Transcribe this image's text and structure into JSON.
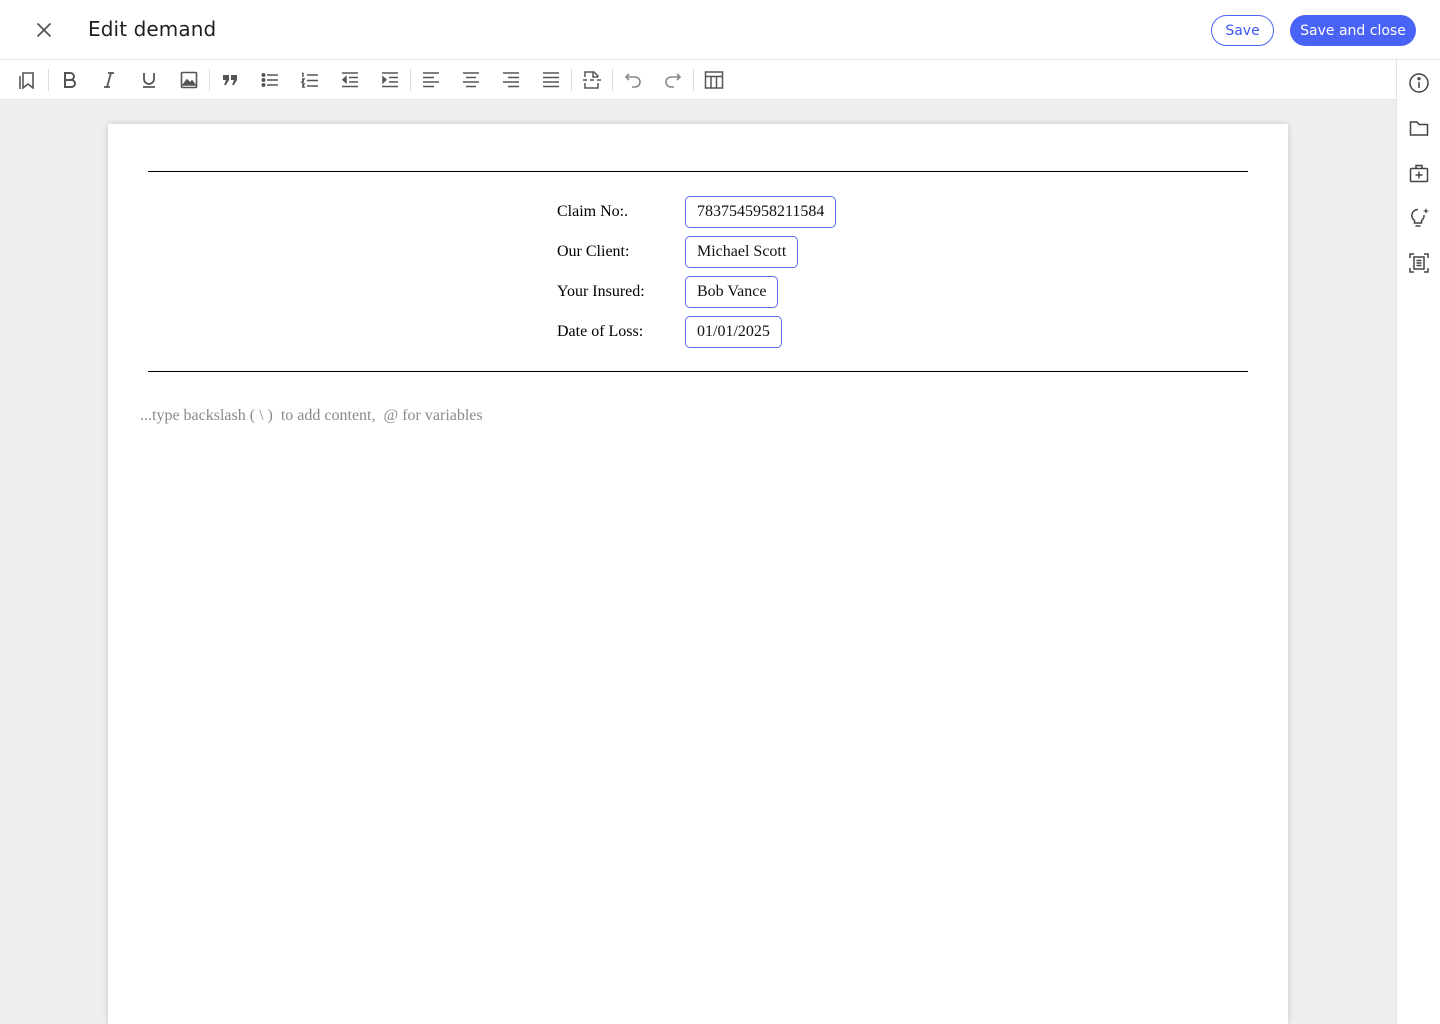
{
  "header": {
    "title": "Edit demand",
    "save_label": "Save",
    "save_close_label": "Save and close"
  },
  "toolbar": {
    "tools": [
      "bookmark-icon",
      "bold-icon",
      "italic-icon",
      "underline-icon",
      "image-icon",
      "blockquote-icon",
      "bullet-list-icon",
      "numbered-list-icon",
      "outdent-icon",
      "indent-icon",
      "align-left-icon",
      "align-center-icon",
      "align-right-icon",
      "align-justify-icon",
      "page-break-icon",
      "undo-icon",
      "redo-icon",
      "table-icon"
    ]
  },
  "sidebar": {
    "tools": [
      "info-icon",
      "folder-icon",
      "medical-bag-icon",
      "lightbulb-sparkle-icon",
      "document-scan-icon"
    ]
  },
  "document": {
    "fields": [
      {
        "label": "Claim No:.",
        "value": "7837545958211584"
      },
      {
        "label": "Our Client:",
        "value": "Michael Scott"
      },
      {
        "label": "Your Insured:",
        "value": "Bob Vance"
      },
      {
        "label": "Date of Loss:",
        "value": "01/01/2025"
      }
    ],
    "placeholder": "...type backslash ( \\ )  to add content,  @ for variables"
  },
  "colors": {
    "accent": "#4a63f7",
    "field_border": "#5b6ee8",
    "canvas": "#efefef"
  }
}
